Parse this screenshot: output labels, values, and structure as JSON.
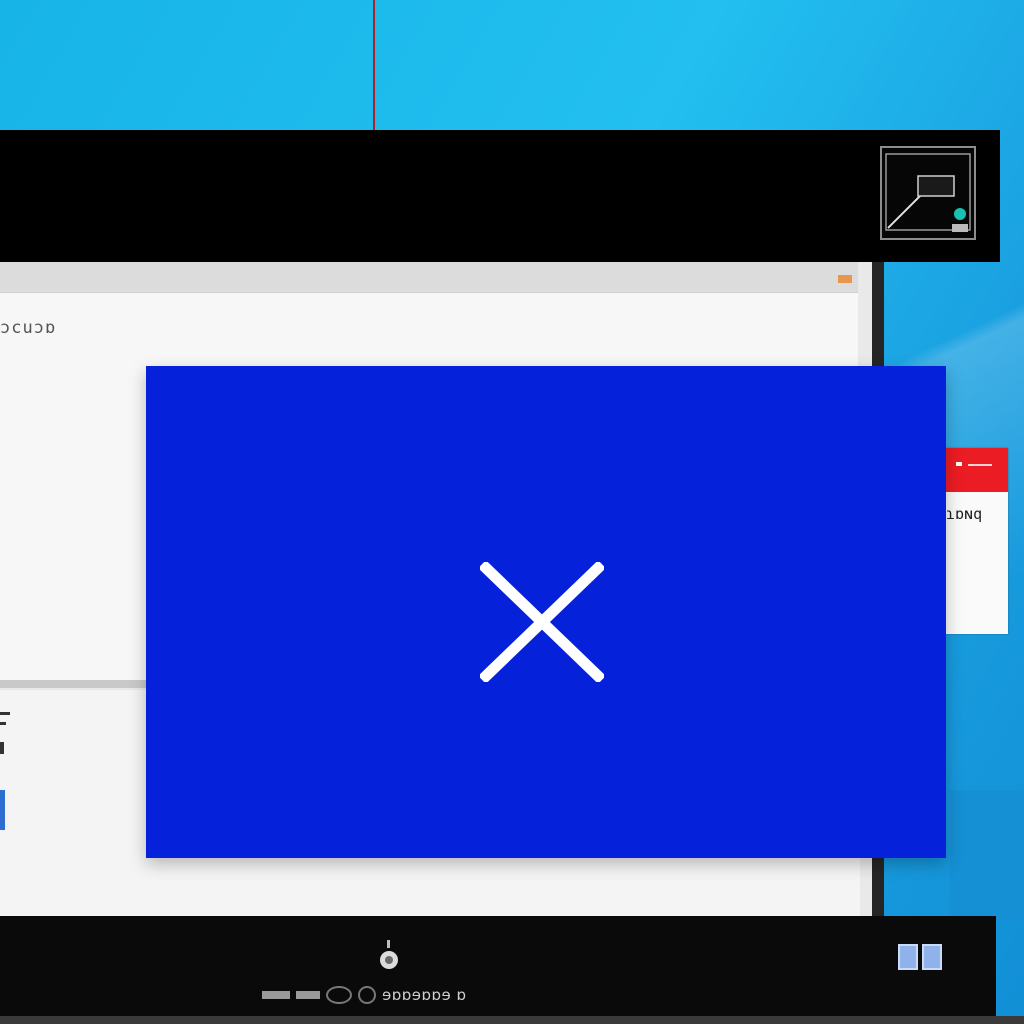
{
  "desktop": {
    "wallpaper_colors": [
      "#17b4e8",
      "#1a9fe0"
    ],
    "accent_red": "#b3202a"
  },
  "window": {
    "titlebar_color": "#000000",
    "titlebar_icon": "camera-thumbnail-icon",
    "toolbar_chip_color": "#e7974d",
    "panel_label": "ɔcuɔɒ"
  },
  "dialog": {
    "background_color": "#0621da",
    "close_icon": "close-icon",
    "close_icon_color": "#ffffff"
  },
  "side_card": {
    "header_color": "#ec1c24",
    "text": "ɿɒɴq"
  },
  "taskbar": {
    "pin_icon": "pin-icon",
    "status_text": "ɘɒɒɘɒɒɘ ɒ",
    "task_view_icon": "task-view-icon"
  }
}
